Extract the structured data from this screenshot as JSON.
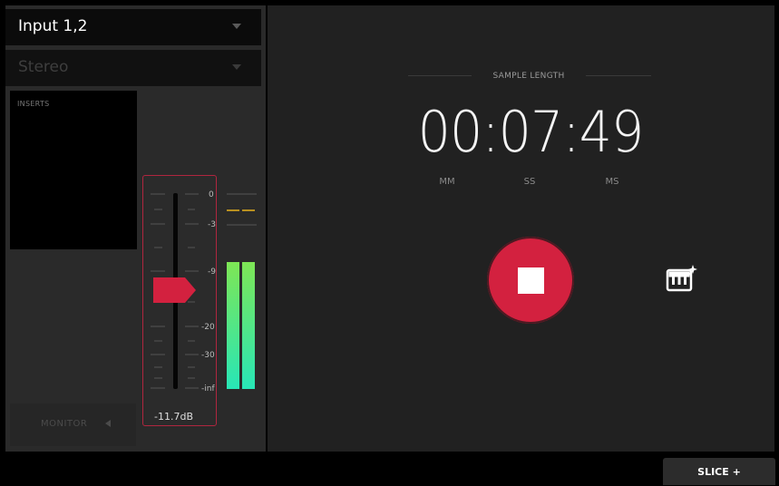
{
  "input": {
    "label": "Input 1,2"
  },
  "mode": {
    "label": "Stereo"
  },
  "inserts": {
    "label": "INSERTS"
  },
  "fader": {
    "scale": [
      "0",
      "-3",
      "-9",
      "-20",
      "-30",
      "-inf"
    ],
    "value_label": "-11.7dB",
    "db": -11.7
  },
  "meter": {
    "level": 0.61,
    "peak_hold": -3
  },
  "monitor": {
    "label": "MONITOR"
  },
  "sample": {
    "header": "SAMPLE LENGTH",
    "time": "00:07:49",
    "units": [
      "MM",
      "SS",
      "MS"
    ]
  },
  "colors": {
    "accent": "#d3213f",
    "meter_top": "#7ee655",
    "meter_bottom": "#28e6b7",
    "peak": "#e8b21c"
  },
  "icons": {
    "stop": "stop-icon",
    "keyboard": "keyboard-sparkle-icon"
  },
  "footer": {
    "slice_label": "SLICE +"
  }
}
